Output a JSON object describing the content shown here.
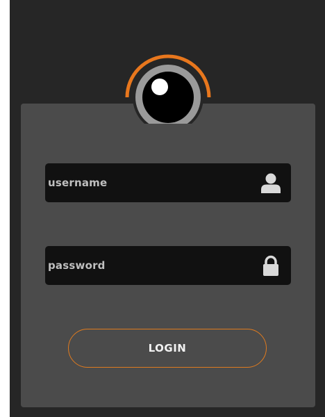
{
  "form": {
    "username": {
      "value": "",
      "placeholder": "username",
      "icon": "user-icon"
    },
    "password": {
      "value": "",
      "placeholder": "password",
      "icon": "lock-icon"
    },
    "login_label": "LOGIN"
  },
  "logo": {
    "icon": "eye-camera-icon"
  },
  "colors": {
    "background": "#262626",
    "card": "#4b4b4b",
    "field": "#111111",
    "accent": "#e07b1f",
    "icon": "#d9d9d9"
  }
}
